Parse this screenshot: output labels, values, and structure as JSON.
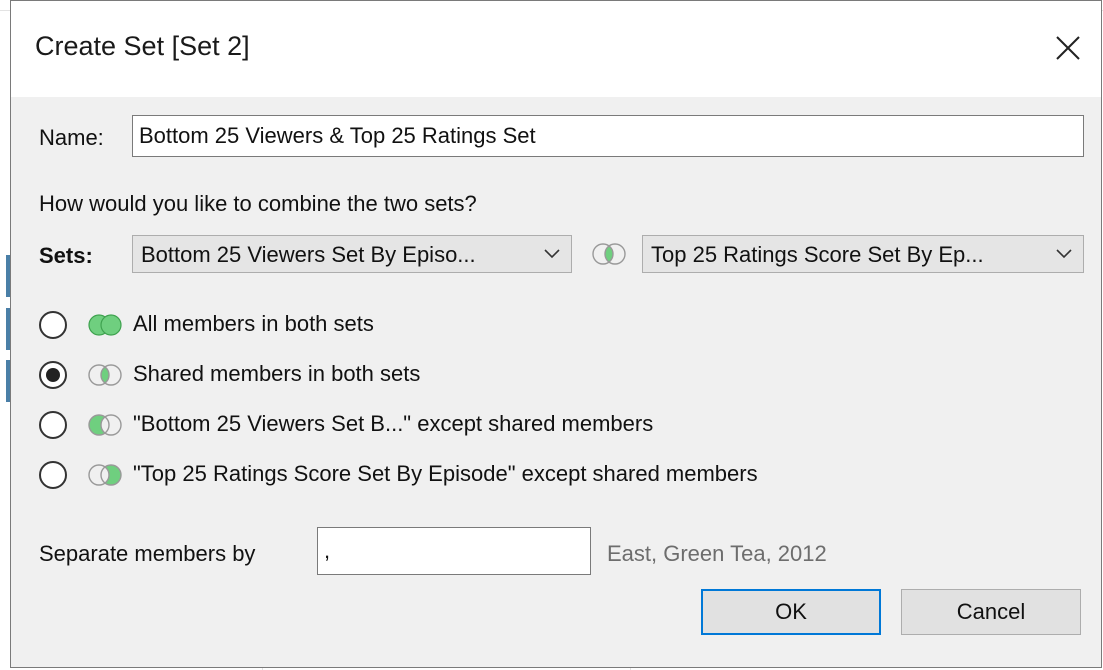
{
  "dialog": {
    "title": "Create Set [Set 2]",
    "close_icon": "close-x-icon"
  },
  "name_field": {
    "label": "Name:",
    "value": "Bottom 25 Viewers & Top 25 Ratings Set"
  },
  "combine_prompt": "How would you like to combine the two sets?",
  "sets": {
    "label": "Sets:",
    "left_selected": "Bottom 25 Viewers Set By Episo...",
    "right_selected": "Top 25 Ratings Score Set By Ep...",
    "combine_icon": "venn-intersection-icon"
  },
  "options": [
    {
      "label": "All members in both sets",
      "selected": false,
      "icon": "venn-union-icon"
    },
    {
      "label": "Shared members in both sets",
      "selected": true,
      "icon": "venn-intersection-icon"
    },
    {
      "label": "\"Bottom 25 Viewers Set B...\" except shared members",
      "selected": false,
      "icon": "venn-left-except-icon"
    },
    {
      "label": "\"Top 25 Ratings Score Set By Episode\" except shared members",
      "selected": false,
      "icon": "venn-right-except-icon"
    }
  ],
  "separator": {
    "label": "Separate members by",
    "value": ",",
    "example": "East, Green Tea, 2012"
  },
  "buttons": {
    "ok": "OK",
    "cancel": "Cancel"
  },
  "colors": {
    "venn_green": "#6fcf7f",
    "venn_green_stroke": "#3fa24f",
    "ok_border": "#0078d7"
  }
}
